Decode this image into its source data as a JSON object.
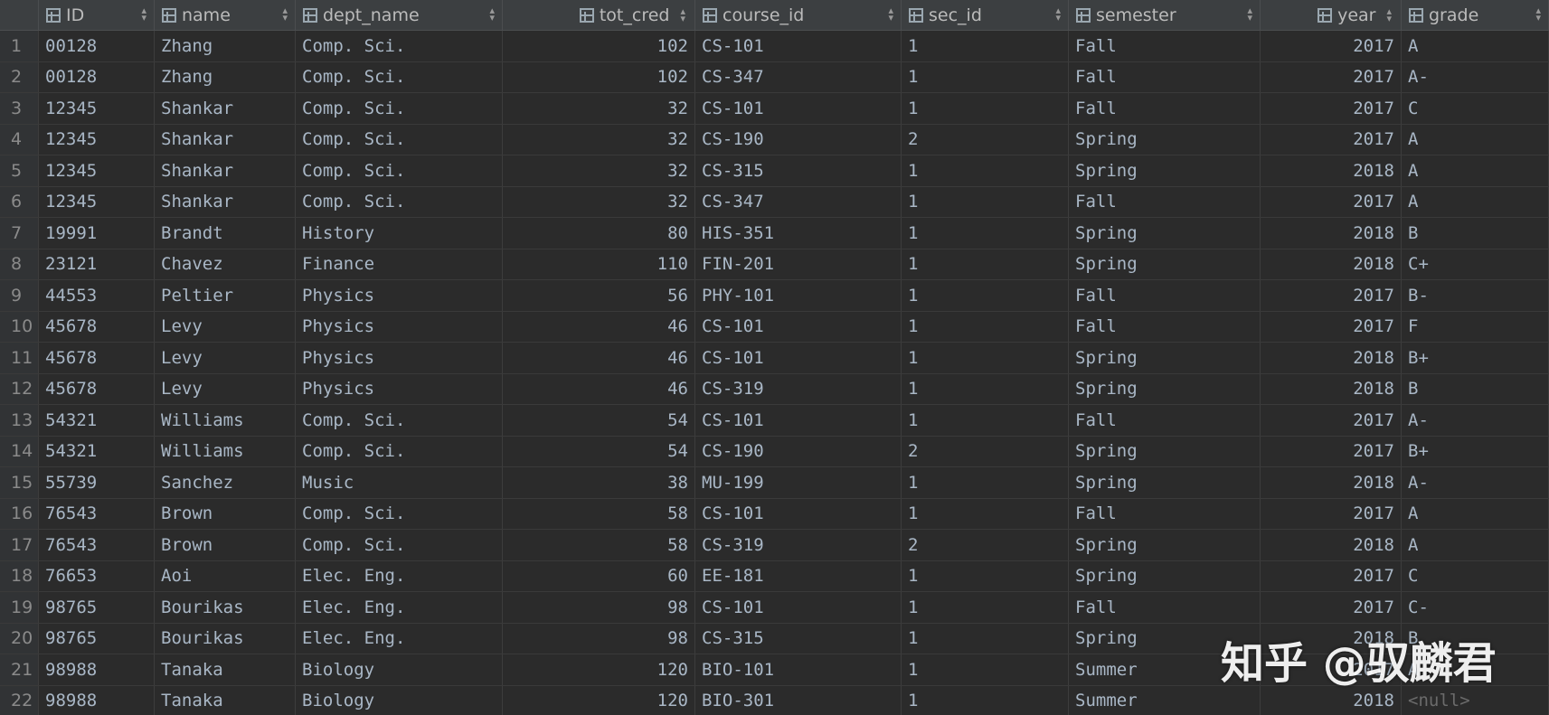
{
  "columns": [
    {
      "label": "ID",
      "align": "left"
    },
    {
      "label": "name",
      "align": "left"
    },
    {
      "label": "dept_name",
      "align": "left"
    },
    {
      "label": "tot_cred",
      "align": "right"
    },
    {
      "label": "course_id",
      "align": "left"
    },
    {
      "label": "sec_id",
      "align": "left"
    },
    {
      "label": "semester",
      "align": "left"
    },
    {
      "label": "year",
      "align": "right"
    },
    {
      "label": "grade",
      "align": "left"
    }
  ],
  "sort_icon": "sort-arrows-icon",
  "column_icon": "table-column-icon",
  "rows": [
    {
      "n": "1",
      "cells": [
        "00128",
        "Zhang",
        "Comp. Sci.",
        "102",
        "CS-101",
        "1",
        "Fall",
        "2017",
        "A"
      ]
    },
    {
      "n": "2",
      "cells": [
        "00128",
        "Zhang",
        "Comp. Sci.",
        "102",
        "CS-347",
        "1",
        "Fall",
        "2017",
        "A-"
      ]
    },
    {
      "n": "3",
      "cells": [
        "12345",
        "Shankar",
        "Comp. Sci.",
        "32",
        "CS-101",
        "1",
        "Fall",
        "2017",
        "C"
      ]
    },
    {
      "n": "4",
      "cells": [
        "12345",
        "Shankar",
        "Comp. Sci.",
        "32",
        "CS-190",
        "2",
        "Spring",
        "2017",
        "A"
      ]
    },
    {
      "n": "5",
      "cells": [
        "12345",
        "Shankar",
        "Comp. Sci.",
        "32",
        "CS-315",
        "1",
        "Spring",
        "2018",
        "A"
      ]
    },
    {
      "n": "6",
      "cells": [
        "12345",
        "Shankar",
        "Comp. Sci.",
        "32",
        "CS-347",
        "1",
        "Fall",
        "2017",
        "A"
      ]
    },
    {
      "n": "7",
      "cells": [
        "19991",
        "Brandt",
        "History",
        "80",
        "HIS-351",
        "1",
        "Spring",
        "2018",
        "B"
      ]
    },
    {
      "n": "8",
      "cells": [
        "23121",
        "Chavez",
        "Finance",
        "110",
        "FIN-201",
        "1",
        "Spring",
        "2018",
        "C+"
      ]
    },
    {
      "n": "9",
      "cells": [
        "44553",
        "Peltier",
        "Physics",
        "56",
        "PHY-101",
        "1",
        "Fall",
        "2017",
        "B-"
      ]
    },
    {
      "n": "10",
      "cells": [
        "45678",
        "Levy",
        "Physics",
        "46",
        "CS-101",
        "1",
        "Fall",
        "2017",
        "F"
      ]
    },
    {
      "n": "11",
      "cells": [
        "45678",
        "Levy",
        "Physics",
        "46",
        "CS-101",
        "1",
        "Spring",
        "2018",
        "B+"
      ]
    },
    {
      "n": "12",
      "cells": [
        "45678",
        "Levy",
        "Physics",
        "46",
        "CS-319",
        "1",
        "Spring",
        "2018",
        "B"
      ]
    },
    {
      "n": "13",
      "cells": [
        "54321",
        "Williams",
        "Comp. Sci.",
        "54",
        "CS-101",
        "1",
        "Fall",
        "2017",
        "A-"
      ]
    },
    {
      "n": "14",
      "cells": [
        "54321",
        "Williams",
        "Comp. Sci.",
        "54",
        "CS-190",
        "2",
        "Spring",
        "2017",
        "B+"
      ]
    },
    {
      "n": "15",
      "cells": [
        "55739",
        "Sanchez",
        "Music",
        "38",
        "MU-199",
        "1",
        "Spring",
        "2018",
        "A-"
      ]
    },
    {
      "n": "16",
      "cells": [
        "76543",
        "Brown",
        "Comp. Sci.",
        "58",
        "CS-101",
        "1",
        "Fall",
        "2017",
        "A"
      ]
    },
    {
      "n": "17",
      "cells": [
        "76543",
        "Brown",
        "Comp. Sci.",
        "58",
        "CS-319",
        "2",
        "Spring",
        "2018",
        "A"
      ]
    },
    {
      "n": "18",
      "cells": [
        "76653",
        "Aoi",
        "Elec. Eng.",
        "60",
        "EE-181",
        "1",
        "Spring",
        "2017",
        "C"
      ]
    },
    {
      "n": "19",
      "cells": [
        "98765",
        "Bourikas",
        "Elec. Eng.",
        "98",
        "CS-101",
        "1",
        "Fall",
        "2017",
        "C-"
      ]
    },
    {
      "n": "20",
      "cells": [
        "98765",
        "Bourikas",
        "Elec. Eng.",
        "98",
        "CS-315",
        "1",
        "Spring",
        "2018",
        "B"
      ]
    },
    {
      "n": "21",
      "cells": [
        "98988",
        "Tanaka",
        "Biology",
        "120",
        "BIO-101",
        "1",
        "Summer",
        "2017",
        "A"
      ]
    },
    {
      "n": "22",
      "cells": [
        "98988",
        "Tanaka",
        "Biology",
        "120",
        "BIO-301",
        "1",
        "Summer",
        "2018",
        "<null>"
      ]
    }
  ],
  "watermark": "知乎 @驭麟君",
  "colors": {
    "background": "#2b2b2b",
    "header": "#3c3f41",
    "text": "#a9b7c6",
    "null": "#6b6b6b"
  }
}
